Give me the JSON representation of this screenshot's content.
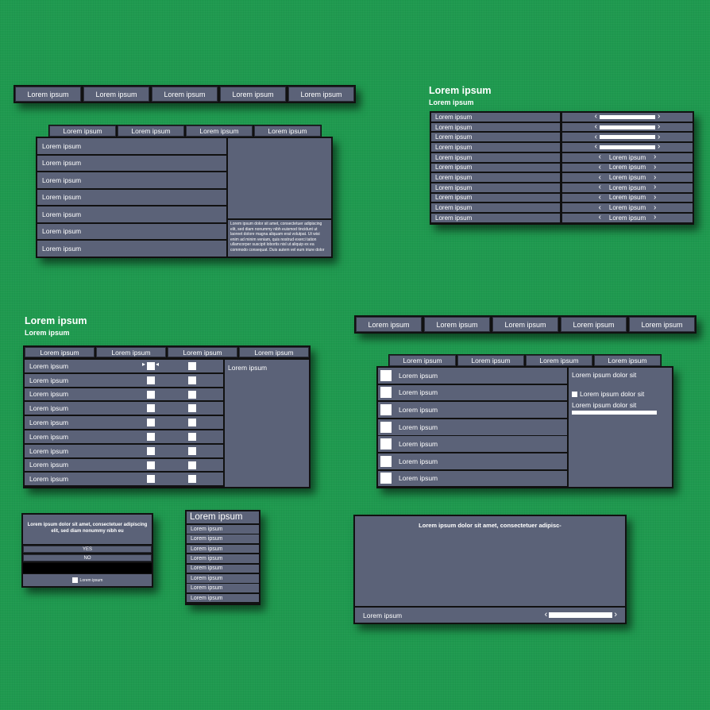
{
  "colors": {
    "background": "#1f9a4f",
    "panel": "#5b6278",
    "border": "#111111",
    "white": "#ffffff"
  },
  "top_bar_1": [
    "Lorem ipsum",
    "Lorem ipsum",
    "Lorem ipsum",
    "Lorem ipsum",
    "Lorem ipsum"
  ],
  "panel_a": {
    "tabs": [
      "Lorem ipsum",
      "Lorem ipsum",
      "Lorem ipsum",
      "Lorem ipsum"
    ],
    "rows": [
      "Lorem ipsum",
      "Lorem ipsum",
      "Lorem ipsum",
      "Lorem ipsum",
      "Lorem ipsum",
      "Lorem ipsum",
      "Lorem ipsum"
    ],
    "paragraph": "Lorem ipsum dolor sit amet, consectetuer adipiscing elit, sed diam nonummy nibh euismod tincidunt ut laoreet dolore magna aliquam erat volutpat. Ut wisi enim ad minim veniam, quis nostrud exerci tation ullamcorper suscipit lobortis nisl ut aliquip ex ea commodo consequat. Duis autem vel eum iriure dolor"
  },
  "settings": {
    "title": "Lorem ipsum",
    "subtitle": "Lorem ipsum",
    "slider_rows": [
      {
        "label": "Lorem ipsum",
        "level": 1.0
      },
      {
        "label": "Lorem ipsum",
        "level": 1.0
      },
      {
        "label": "Lorem ipsum",
        "level": 1.0
      },
      {
        "label": "Lorem ipsum",
        "level": 1.0
      }
    ],
    "select_rows": [
      {
        "label": "Lorem ipsum",
        "value": "Lorem ipsum"
      },
      {
        "label": "Lorem ipsum",
        "value": "Lorem ipsum"
      },
      {
        "label": "Lorem ipsum",
        "value": "Lorem ipsum"
      },
      {
        "label": "Lorem ipsum",
        "value": "Lorem ipsum"
      },
      {
        "label": "Lorem ipsum",
        "value": "Lorem ipsum"
      },
      {
        "label": "Lorem ipsum",
        "value": "Lorem ipsum"
      },
      {
        "label": "Lorem ipsum",
        "value": "Lorem ipsum"
      }
    ]
  },
  "panel_b": {
    "title": "Lorem ipsum",
    "subtitle": "Lorem ipsum",
    "tabs": [
      "Lorem ipsum",
      "Lorem ipsum",
      "Lorem ipsum",
      "Lorem ipsum"
    ],
    "rows": [
      "Lorem ipsum",
      "Lorem ipsum",
      "Lorem ipsum",
      "Lorem ipsum",
      "Lorem ipsum",
      "Lorem ipsum",
      "Lorem ipsum",
      "Lorem ipsum",
      "Lorem ipsum"
    ],
    "side_label": "Lorem ipsum"
  },
  "top_bar_2": [
    "Lorem ipsum",
    "Lorem ipsum",
    "Lorem ipsum",
    "Lorem ipsum",
    "Lorem ipsum"
  ],
  "panel_c": {
    "tabs": [
      "Lorem ipsum",
      "Lorem ipsum",
      "Lorem ipsum",
      "Lorem ipsum"
    ],
    "rows": [
      "Lorem ipsum",
      "Lorem ipsum",
      "Lorem ipsum",
      "Lorem ipsum",
      "Lorem ipsum",
      "Lorem ipsum",
      "Lorem ipsum"
    ],
    "side_line_1": "Lorem ipsum dolor sit",
    "side_check_label": "Lorem ipsum dolor sit",
    "side_line_3": "Lorem ipsum dolor sit",
    "progress": 1.0
  },
  "dialog": {
    "message": "Lorem ipsum dolor sit amet, consectetuer adipiscing elit, sed diam nonummy nibh eu",
    "yes": "YES",
    "no": "NO",
    "check_label": "Lorem ipsum"
  },
  "list_panel": {
    "title": "Lorem ipsum",
    "items": [
      "Lorem ipsum",
      "Lorem ipsum",
      "Lorem ipsum",
      "Lorem ipsum",
      "Lorem ipsum",
      "Lorem ipsum",
      "Lorem ipsum",
      "Lorem ipsum"
    ]
  },
  "big_panel": {
    "message": "Lorem ipsum dolor sit amet, consectetuer adipisc-",
    "footer_label": "Lorem ipsum",
    "slider_level": 1.0
  }
}
